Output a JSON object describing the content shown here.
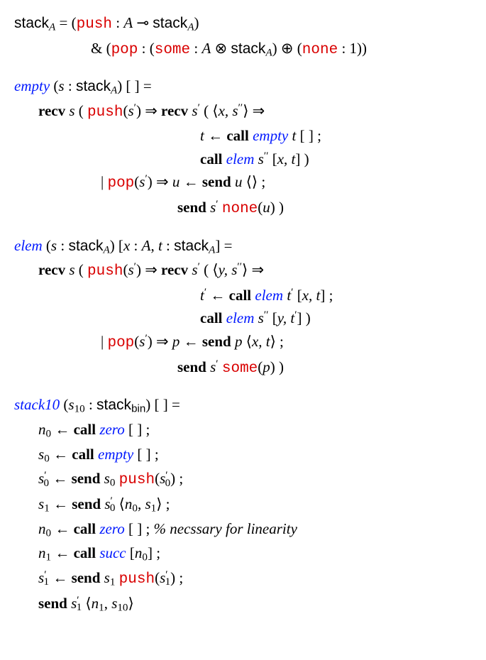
{
  "l1a": "stack",
  "l1b": "A",
  "l1c": " = (",
  "l1d": "push",
  "l1e": " : ",
  "l1f": "A",
  "l1g": " ⊸ ",
  "l1h": "stack",
  "l1i": "A",
  "l1j": ")",
  "l2a": "& (",
  "l2b": "pop",
  "l2c": " : (",
  "l2d": "some",
  "l2e": " : ",
  "l2f": "A",
  "l2g": " ⊗ ",
  "l2h": "stack",
  "l2i": "A",
  "l2j": ") ⊕ (",
  "l2k": "none",
  "l2l": " : 1))",
  "e1a": "empty",
  "e1b": " (",
  "e1c": "s",
  "e1d": " : ",
  "e1e": "stack",
  "e1f": "A",
  "e1g": ") [ ] =",
  "e2a": "recv ",
  "e2b": "s",
  "e2c": " ( ",
  "e2d": "push",
  "e2e": "(",
  "e2f": "s",
  "e2g": "′",
  "e2h": ") ⇒ ",
  "e2i": "recv ",
  "e2j": "s",
  "e2k": "′",
  "e2l": " ( ⟨",
  "e2m": "x, s",
  "e2n": "′′",
  "e2o": "⟩ ⇒",
  "e3a": "t",
  "e3b": " ← ",
  "e3c": "call ",
  "e3d": "empty",
  "e3e": " t",
  "e3f": " [ ] ;",
  "e4a": "call ",
  "e4b": "elem",
  "e4c": " s",
  "e4d": "′′",
  "e4e": " [",
  "e4f": "x, t",
  "e4g": "] )",
  "e5a": "| ",
  "e5b": "pop",
  "e5c": "(",
  "e5d": "s",
  "e5e": "′",
  "e5f": ") ⇒ ",
  "e5g": "u",
  "e5h": " ← ",
  "e5i": "send ",
  "e5j": "u",
  "e5k": " ⟨⟩ ;",
  "e6a": "send ",
  "e6b": "s",
  "e6c": "′",
  "e6d": " ",
  "e6e": "none",
  "e6f": "(",
  "e6g": "u",
  "e6h": ") )",
  "m1a": "elem",
  "m1b": " (",
  "m1c": "s",
  "m1d": " : ",
  "m1e": "stack",
  "m1f": "A",
  "m1g": ") [",
  "m1h": "x",
  "m1i": " : ",
  "m1j": "A",
  "m1k": ", ",
  "m1l": "t",
  "m1m": " : ",
  "m1n": "stack",
  "m1o": "A",
  "m1p": "] =",
  "m2a": "recv ",
  "m2b": "s",
  "m2c": " ( ",
  "m2d": "push",
  "m2e": "(",
  "m2f": "s",
  "m2g": "′",
  "m2h": ") ⇒ ",
  "m2i": "recv ",
  "m2j": "s",
  "m2k": "′",
  "m2l": " ( ⟨",
  "m2m": "y, s",
  "m2n": "′′",
  "m2o": "⟩ ⇒",
  "m3a": "t",
  "m3b": "′",
  "m3c": " ← ",
  "m3d": "call ",
  "m3e": "elem",
  "m3f": " t",
  "m3g": "′",
  "m3h": " [",
  "m3i": "x, t",
  "m3j": "] ;",
  "m4a": "call ",
  "m4b": "elem",
  "m4c": " s",
  "m4d": "′′",
  "m4e": " [",
  "m4f": "y, t",
  "m4g": "′",
  "m4h": "] )",
  "m5a": "| ",
  "m5b": "pop",
  "m5c": "(",
  "m5d": "s",
  "m5e": "′",
  "m5f": ") ⇒ ",
  "m5g": "p",
  "m5h": " ← ",
  "m5i": "send ",
  "m5j": "p",
  "m5k": " ⟨",
  "m5l": "x, t",
  "m5m": "⟩ ;",
  "m6a": "send ",
  "m6b": "s",
  "m6c": "′",
  "m6d": " ",
  "m6e": "some",
  "m6f": "(",
  "m6g": "p",
  "m6h": ") )",
  "s1a": "stack10",
  "s1b": " (",
  "s1c": "s",
  "s1d": "10",
  "s1e": " : ",
  "s1f": "stack",
  "s1g": "bin",
  "s1h": ") [ ] =",
  "s2a": "n",
  "s2b": "0",
  "s2c": " ← ",
  "s2d": "call ",
  "s2e": "zero",
  "s2f": " [ ] ;",
  "s3a": "s",
  "s3b": "0",
  "s3c": " ← ",
  "s3d": "call ",
  "s3e": "empty",
  "s3f": " [ ] ;",
  "s4a": "s",
  "s4b": "′",
  "s4c": "0",
  "s4d": " ← ",
  "s4e": "send ",
  "s4f": "s",
  "s4g": "0",
  "s4h": " ",
  "s4i": "push",
  "s4j": "(",
  "s4k": "s",
  "s4l": "′",
  "s4m": "0",
  "s4n": ") ;",
  "s5a": "s",
  "s5b": "1",
  "s5c": " ← ",
  "s5d": "send ",
  "s5e": "s",
  "s5f": "′",
  "s5g": "0",
  "s5h": " ⟨",
  "s5i": "n",
  "s5j": "0",
  "s5k": ", ",
  "s5l": "s",
  "s5m": "1",
  "s5n": "⟩ ;",
  "s6a": "n",
  "s6b": "0",
  "s6c": " ← ",
  "s6d": "call ",
  "s6e": "zero",
  "s6f": " [ ] ;        ",
  "s6g": "% necssary for linearity",
  "s7a": "n",
  "s7b": "1",
  "s7c": " ← ",
  "s7d": "call ",
  "s7e": "succ",
  "s7f": " [",
  "s7g": "n",
  "s7h": "0",
  "s7i": "] ;",
  "s8a": "s",
  "s8b": "′",
  "s8c": "1",
  "s8d": " ← ",
  "s8e": "send ",
  "s8f": "s",
  "s8g": "1",
  "s8h": " ",
  "s8i": "push",
  "s8j": "(",
  "s8k": "s",
  "s8l": "′",
  "s8m": "1",
  "s8n": ") ;",
  "s9a": "send ",
  "s9b": "s",
  "s9c": "′",
  "s9d": "1",
  "s9e": " ⟨",
  "s9f": "n",
  "s9g": "1",
  "s9h": ", ",
  "s9i": "s",
  "s9j": "10",
  "s9k": "⟩"
}
